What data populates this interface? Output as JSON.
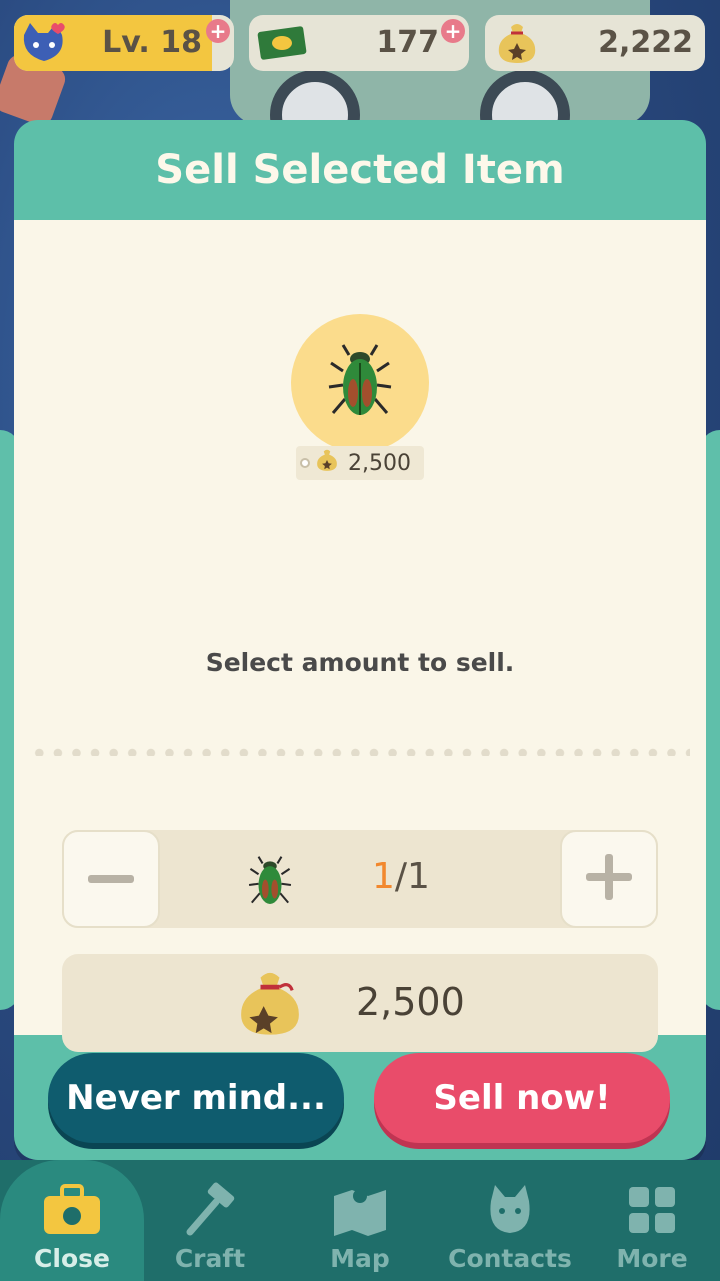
{
  "hud": {
    "level_label": "Lv. 18",
    "level_progress_fraction": 0.9,
    "tickets": "177",
    "bells": "2,222",
    "add_icon": "plus-icon"
  },
  "dialog": {
    "title": "Sell Selected Item",
    "item_icon": "beetle-icon",
    "unit_price": "2,500",
    "prompt": "Select amount to sell.",
    "quantity_current": "1",
    "quantity_separator": "/",
    "quantity_max": "1",
    "total": "2,500",
    "cancel_label": "Never mind...",
    "confirm_label": "Sell now!"
  },
  "nav": {
    "items": [
      {
        "label": "Close",
        "icon": "bag-icon"
      },
      {
        "label": "Craft",
        "icon": "hammer-icon"
      },
      {
        "label": "Map",
        "icon": "map-icon"
      },
      {
        "label": "Contacts",
        "icon": "cat-icon"
      },
      {
        "label": "More",
        "icon": "grid-icon"
      }
    ]
  },
  "colors": {
    "header_teal": "#5dbfa9",
    "cream": "#faf6e8",
    "cancel_button": "#0f5c6e",
    "sell_button": "#e94c6a",
    "quantity_accent": "#f2882e",
    "nav_bar": "#1f6e6a"
  }
}
